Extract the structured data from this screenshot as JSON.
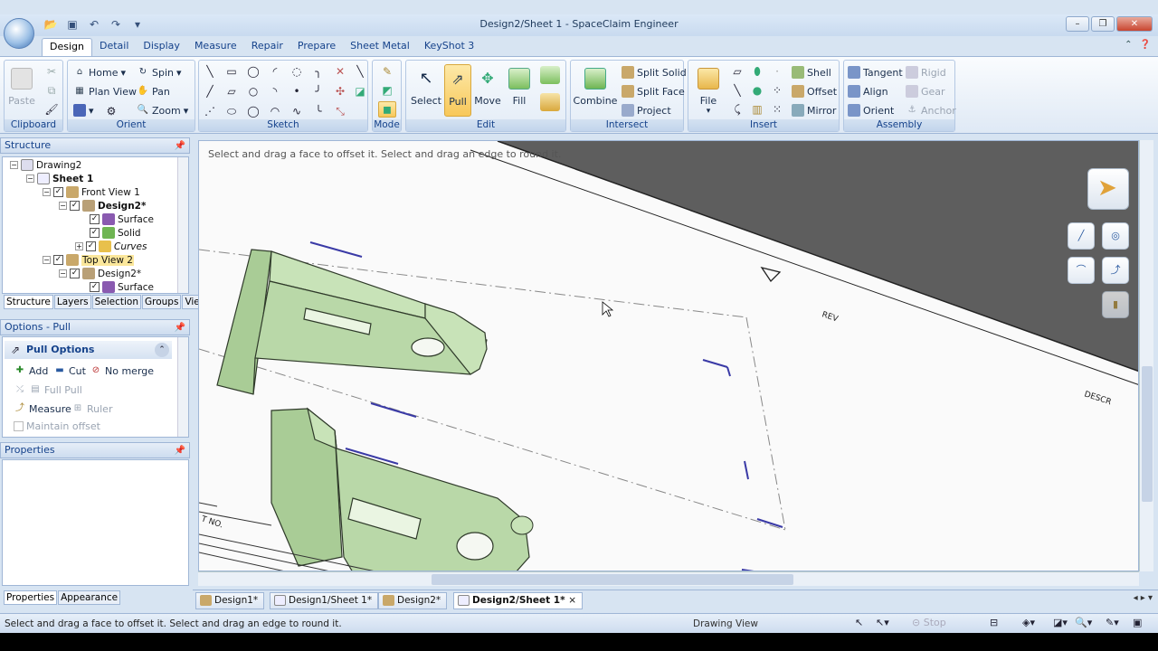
{
  "window": {
    "title": "Design2/Sheet 1 - SpaceClaim Engineer"
  },
  "tabs": [
    "Design",
    "Detail",
    "Display",
    "Measure",
    "Repair",
    "Prepare",
    "Sheet Metal",
    "KeyShot 3"
  ],
  "ribbon": {
    "clipboard": {
      "label": "Clipboard",
      "paste": "Paste"
    },
    "orient": {
      "label": "Orient",
      "home": "Home",
      "plan_view": "Plan View",
      "spin": "Spin",
      "pan": "Pan",
      "zoom": "Zoom"
    },
    "sketch": {
      "label": "Sketch"
    },
    "mode": {
      "label": "Mode"
    },
    "edit": {
      "label": "Edit",
      "select": "Select",
      "pull": "Pull",
      "move": "Move",
      "fill": "Fill"
    },
    "intersect": {
      "label": "Intersect",
      "combine": "Combine",
      "split_solid": "Split Solid",
      "split_face": "Split Face",
      "project": "Project"
    },
    "insert": {
      "label": "Insert",
      "file": "File",
      "shell": "Shell",
      "offset": "Offset",
      "mirror": "Mirror"
    },
    "assembly": {
      "label": "Assembly",
      "tangent": "Tangent",
      "align": "Align",
      "orient": "Orient",
      "rigid": "Rigid",
      "gear": "Gear",
      "anchor": "Anchor"
    }
  },
  "structure": {
    "title": "Structure",
    "tree": [
      {
        "label": "Drawing2",
        "level": 0
      },
      {
        "label": "Sheet 1",
        "level": 1
      },
      {
        "label": "Front View 1",
        "level": 2
      },
      {
        "label": "Design2*",
        "level": 3
      },
      {
        "label": "Surface",
        "level": 4
      },
      {
        "label": "Solid",
        "level": 4
      },
      {
        "label": "Curves",
        "level": 4
      },
      {
        "label": "Top View 2",
        "level": 2
      },
      {
        "label": "Design2*",
        "level": 3
      },
      {
        "label": "Surface",
        "level": 4
      }
    ],
    "tabs": [
      "Structure",
      "Layers",
      "Selection",
      "Groups",
      "Views"
    ]
  },
  "options": {
    "title": "Options - Pull",
    "header": "Pull Options",
    "add": "Add",
    "cut": "Cut",
    "no_merge": "No merge",
    "full_pull": "Full Pull",
    "measure": "Measure",
    "ruler": "Ruler",
    "maintain_offset": "Maintain offset"
  },
  "properties": {
    "title": "Properties",
    "tabs": [
      "Properties",
      "Appearance"
    ]
  },
  "viewport": {
    "hint": "Select and drag a face to offset it. Select and drag an edge to round it.",
    "rev_label": "REV",
    "desc_label": "DESCR",
    "no_label": "T NO."
  },
  "doc_tabs": [
    "Design1*",
    "Design1/Sheet 1*",
    "Design2*",
    "Design2/Sheet 1*"
  ],
  "status": {
    "text": "Select and drag a face to offset it. Select and drag an edge to round it.",
    "view": "Drawing View",
    "stop": "Stop"
  },
  "colors": {
    "part_fill": "#b9d8a8",
    "part_edge": "#2f3a2a",
    "dark_band": "#5e5e5e",
    "dash_blue": "#3a3aa6"
  }
}
